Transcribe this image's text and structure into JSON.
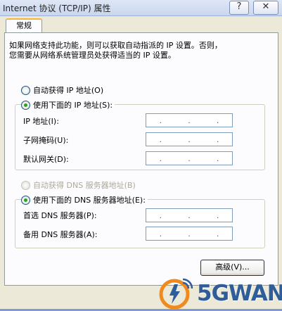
{
  "window": {
    "title": "Internet 协议 (TCP/IP) 属性",
    "help_glyph": "?",
    "close_glyph": "✕"
  },
  "tabs": [
    {
      "label": "常规",
      "selected": true
    }
  ],
  "intro": {
    "line1": "如果网络支持此功能，则可以获取自动指派的 IP 设置。否则，",
    "line2": "您需要从网络系统管理员处获得适当的 IP 设置。"
  },
  "ip": {
    "auto_label": "自动获得 IP 地址(O)",
    "manual_label": "使用下面的 IP 地址(S):",
    "selected": "manual",
    "fields": [
      {
        "label": "IP 地址(I):",
        "dots": ".",
        "value": ""
      },
      {
        "label": "子网掩码(U):",
        "dots": ".",
        "value": ""
      },
      {
        "label": "默认网关(D):",
        "dots": ".",
        "value": ""
      }
    ]
  },
  "dns": {
    "auto_label": "自动获得 DNS 服务器地址(B)",
    "auto_enabled": false,
    "manual_label": "使用下面的 DNS 服务器地址(E):",
    "selected": "manual",
    "fields": [
      {
        "label": "首选 DNS 服务器(P):",
        "dots": ".",
        "value": ""
      },
      {
        "label": "备用 DNS 服务器(A):",
        "dots": ".",
        "value": ""
      }
    ]
  },
  "advanced_button": "高级(V)...",
  "watermark": {
    "text": "5GWAN",
    "icon": "5gwan-logo"
  },
  "colors": {
    "tab_highlight": "#f6b33c",
    "radio_selected": "#2f9e27",
    "watermark": "#2f5d9a"
  }
}
